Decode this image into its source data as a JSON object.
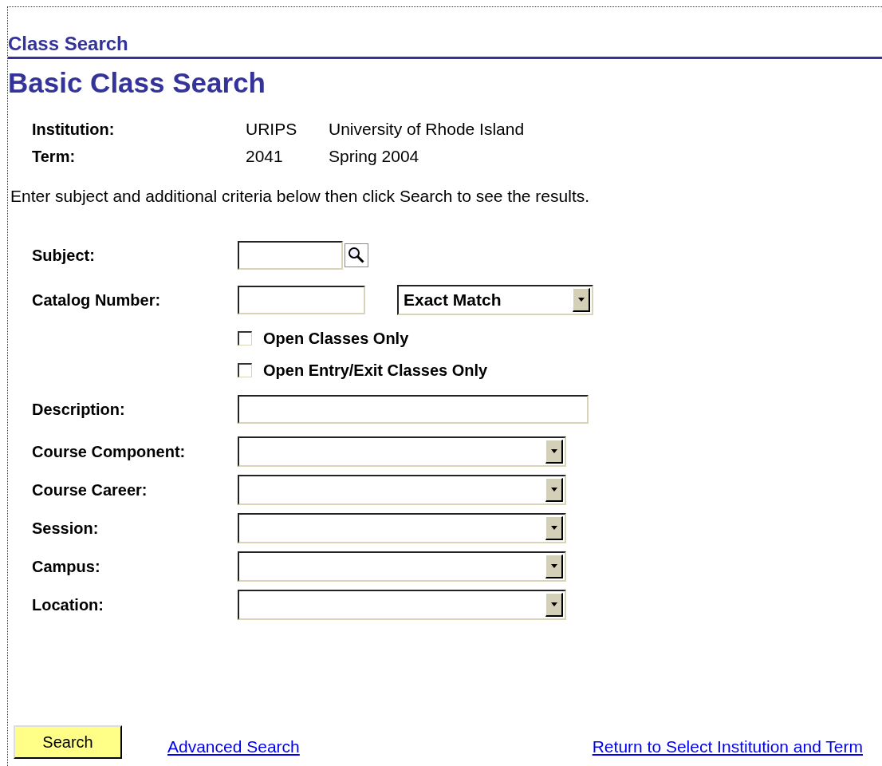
{
  "page_title": "Class Search",
  "heading": "Basic Class Search",
  "info": [
    {
      "label": "Institution:",
      "code": "URIPS",
      "value": "University of Rhode Island"
    },
    {
      "label": "Term:",
      "code": "2041",
      "value": "Spring 2004"
    }
  ],
  "instructions": "Enter subject and additional criteria below then click Search to see the results.",
  "fields": [
    {
      "kind": "lookup",
      "label": "Subject:"
    },
    {
      "kind": "text_select",
      "label": "Catalog Number:",
      "option": "Exact Match"
    },
    {
      "kind": "checkbox",
      "label": "Open Classes Only",
      "checked": false
    },
    {
      "kind": "checkbox",
      "label": "Open Entry/Exit Classes Only",
      "checked": false
    },
    {
      "kind": "text",
      "label": "Description:"
    },
    {
      "kind": "select",
      "label": "Course Component:"
    },
    {
      "kind": "select",
      "label": "Course Career:"
    },
    {
      "kind": "select",
      "label": "Session:"
    },
    {
      "kind": "select",
      "label": "Campus:"
    },
    {
      "kind": "select",
      "label": "Location:"
    }
  ],
  "search_button": "Search",
  "links": [
    "Advanced Search",
    "Return to Select Institution and Term"
  ]
}
